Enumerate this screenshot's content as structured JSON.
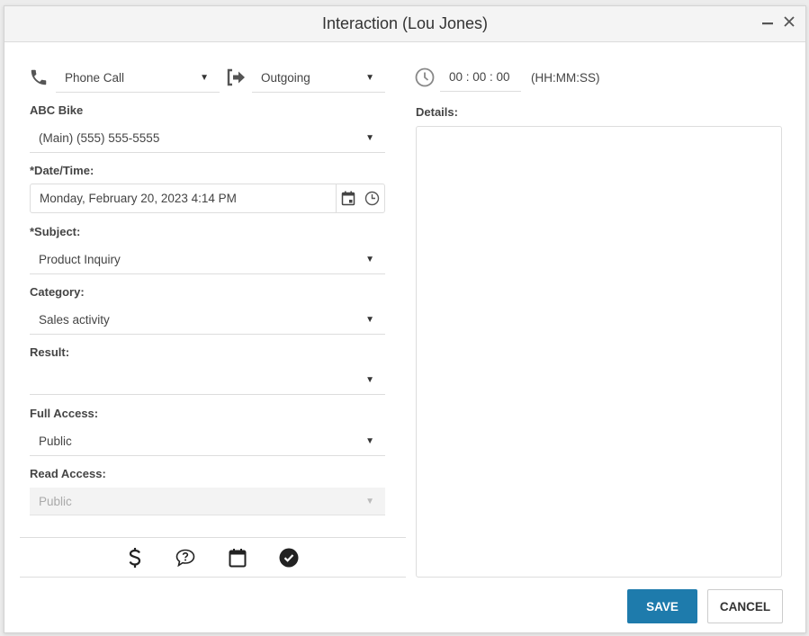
{
  "window": {
    "title": "Interaction (Lou Jones)",
    "minimize_label": "–",
    "close_label": "✕"
  },
  "left": {
    "interaction_type": {
      "icon": "phone-icon",
      "value": "Phone Call"
    },
    "direction": {
      "icon": "sign-out-arrow-icon",
      "value": "Outgoing"
    },
    "contact_label": "ABC Bike",
    "contact_phone": "(Main) (555) 555-5555",
    "datetime": {
      "label": "*Date/Time:",
      "value": "Monday, February 20, 2023 4:14 PM"
    },
    "subject": {
      "label": "*Subject:",
      "value": "Product Inquiry"
    },
    "category": {
      "label": "Category:",
      "value": "Sales activity"
    },
    "result": {
      "label": "Result:",
      "value": ""
    },
    "full_access": {
      "label": "Full Access:",
      "value": "Public"
    },
    "read_access": {
      "label": "Read Access:",
      "value": "Public",
      "disabled": true
    },
    "toolbar_icons": [
      "dollar-icon",
      "question-bubble-icon",
      "calendar-icon",
      "check-circle-icon"
    ]
  },
  "right": {
    "duration": {
      "value": "00 : 00 : 00",
      "format_hint": "(HH:MM:SS)"
    },
    "details": {
      "label": "Details:",
      "value": ""
    }
  },
  "footer": {
    "save_label": "SAVE",
    "cancel_label": "CANCEL"
  },
  "colors": {
    "primary": "#1e7bac"
  }
}
